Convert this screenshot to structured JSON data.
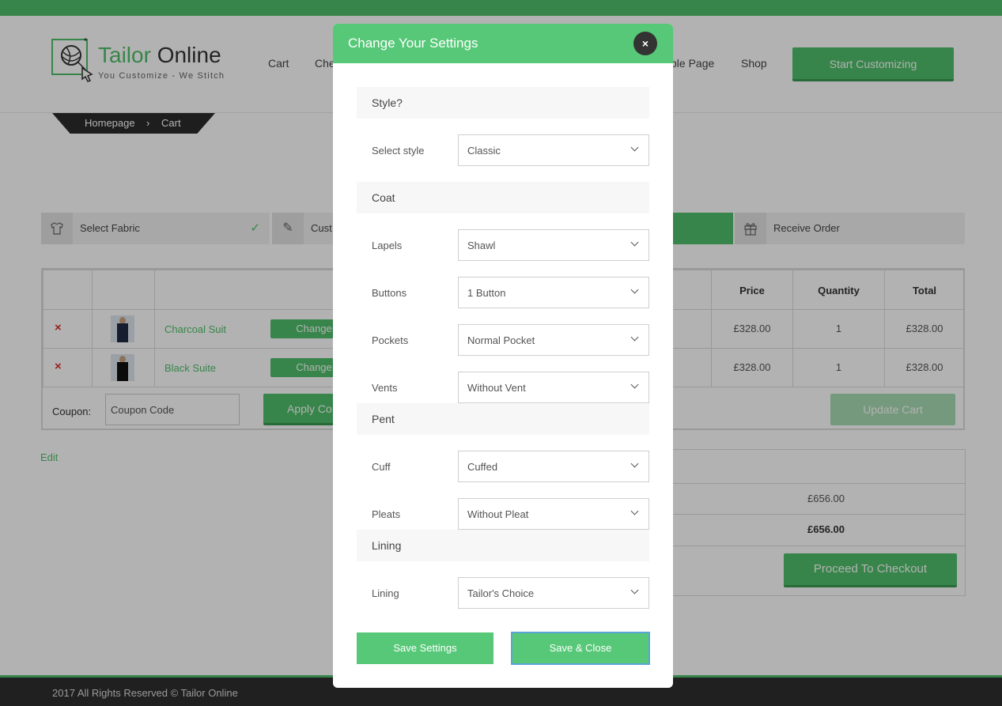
{
  "colors": {
    "accent": "#4fbf6a",
    "modal_header": "#57c878",
    "remove": "#d9342b",
    "footer_bg": "#2e2e2e"
  },
  "logo": {
    "name_part1": "Tailor",
    "name_part2": "Online",
    "tagline": "You Customize - We Stitch",
    "icon": "yarn-ball-cursor-icon"
  },
  "nav": {
    "items": [
      "Cart",
      "Che",
      "ple Page",
      "Shop"
    ],
    "cta": "Start Customizing"
  },
  "breadcrumb": {
    "home": "Homepage",
    "separator": "›",
    "current": "Cart"
  },
  "steps": [
    {
      "label": "Select Fabric",
      "icon": "shirt-icon",
      "done": true
    },
    {
      "label": "Cust",
      "icon": "pencil-icon",
      "done": false
    },
    {
      "label": "Receive Order",
      "icon": "gift-icon",
      "done": false
    }
  ],
  "cart": {
    "headers": {
      "price": "Price",
      "quantity": "Quantity",
      "total": "Total"
    },
    "rows": [
      {
        "remove": "×",
        "name": "Charcoal Suit",
        "change": "Change",
        "price": "£328.00",
        "quantity": "1",
        "total": "£328.00"
      },
      {
        "remove": "×",
        "name": "Black Suite",
        "change": "Change",
        "price": "£328.00",
        "quantity": "1",
        "total": "£328.00"
      }
    ],
    "coupon_label": "Coupon:",
    "coupon_placeholder": "Coupon Code",
    "apply_label": "Apply Co",
    "update_label": "Update Cart"
  },
  "edit_link": "Edit",
  "totals": {
    "subtotal": "£656.00",
    "total": "£656.00",
    "checkout": "Proceed To Checkout"
  },
  "footer": {
    "text": "2017 All Rights Reserved © Tailor Online"
  },
  "modal": {
    "title": "Change Your Settings",
    "close": "×",
    "sections": {
      "style": "Style?",
      "coat": "Coat",
      "pent": "Pent",
      "lining": "Lining"
    },
    "fields": {
      "style": {
        "label": "Select style",
        "value": "Classic"
      },
      "lapels": {
        "label": "Lapels",
        "value": "Shawl"
      },
      "buttons": {
        "label": "Buttons",
        "value": "1 Button"
      },
      "pockets": {
        "label": "Pockets",
        "value": "Normal Pocket"
      },
      "vents": {
        "label": "Vents",
        "value": "Without Vent"
      },
      "cuff": {
        "label": "Cuff",
        "value": "Cuffed"
      },
      "pleats": {
        "label": "Pleats",
        "value": "Without Pleat"
      },
      "lining": {
        "label": "Lining",
        "value": "Tailor's Choice"
      }
    },
    "save_label": "Save Settings",
    "save_close_label": "Save & Close"
  }
}
